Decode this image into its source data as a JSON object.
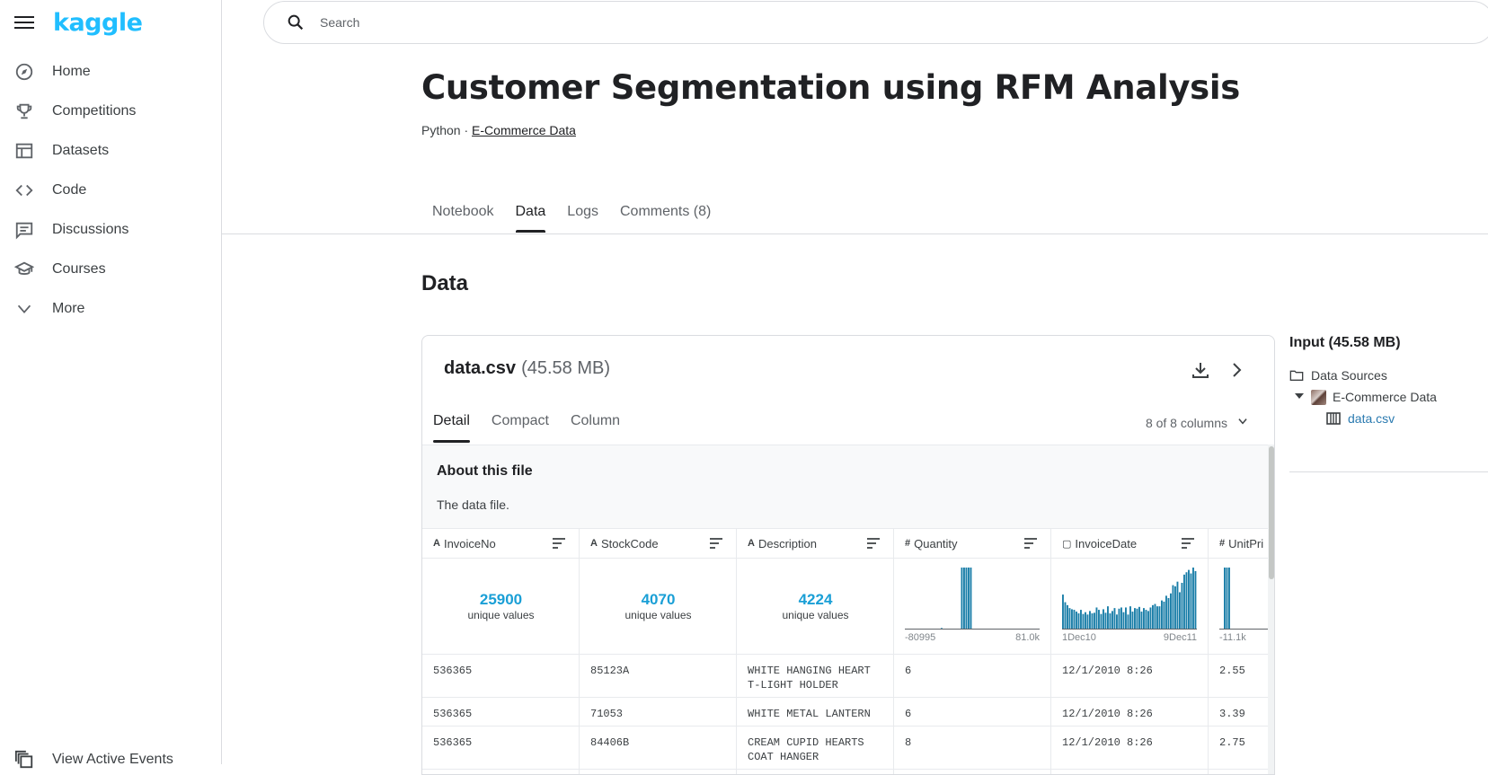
{
  "brand": {
    "logo_text": "kaggle",
    "accent": "#20beff"
  },
  "sidebar": {
    "items": [
      {
        "label": "Home",
        "icon": "compass-icon"
      },
      {
        "label": "Competitions",
        "icon": "trophy-icon"
      },
      {
        "label": "Datasets",
        "icon": "table-icon"
      },
      {
        "label": "Code",
        "icon": "code-icon"
      },
      {
        "label": "Discussions",
        "icon": "comments-icon"
      },
      {
        "label": "Courses",
        "icon": "school-icon"
      },
      {
        "label": "More",
        "icon": "chevron-down-icon"
      }
    ],
    "bottom_item": {
      "label": "View Active Events",
      "icon": "events-icon"
    }
  },
  "search": {
    "placeholder": "Search"
  },
  "notebook": {
    "title": "Customer Segmentation using RFM Analysis",
    "language": "Python",
    "separator": " · ",
    "dataset_link": "E-Commerce Data"
  },
  "tabs": [
    {
      "label": "Notebook",
      "active": false
    },
    {
      "label": "Data",
      "active": true
    },
    {
      "label": "Logs",
      "active": false
    },
    {
      "label": "Comments (8)",
      "active": false
    }
  ],
  "section_title": "Data",
  "file": {
    "name": "data.csv",
    "size": "(45.58 MB)",
    "view_tabs": [
      "Detail",
      "Compact",
      "Column"
    ],
    "columns_selector": "8 of 8 columns",
    "about_title": "About this file",
    "about_text": "The data file."
  },
  "table": {
    "columns": [
      {
        "name": "InvoiceNo",
        "type_icon": "A",
        "kind": "string",
        "unique": "25900",
        "unique_label": "unique values"
      },
      {
        "name": "StockCode",
        "type_icon": "A",
        "kind": "string",
        "unique": "4070",
        "unique_label": "unique values"
      },
      {
        "name": "Description",
        "type_icon": "A",
        "kind": "string",
        "unique": "4224",
        "unique_label": "unique values"
      },
      {
        "name": "Quantity",
        "type_icon": "#",
        "kind": "hist",
        "min_label": "-80995",
        "max_label": "81.0k"
      },
      {
        "name": "InvoiceDate",
        "type_icon": "▢",
        "kind": "hist",
        "min_label": "1Dec10",
        "max_label": "9Dec11"
      },
      {
        "name": "UnitPri",
        "type_icon": "#",
        "kind": "hist",
        "min_label": "-11.1k",
        "max_label": ""
      }
    ],
    "rows": [
      [
        "536365",
        "85123A",
        "WHITE HANGING HEART T-LIGHT HOLDER",
        "6",
        "12/1/2010 8:26",
        "2.55"
      ],
      [
        "536365",
        "71053",
        "WHITE METAL LANTERN",
        "6",
        "12/1/2010 8:26",
        "3.39"
      ],
      [
        "536365",
        "84406B",
        "CREAM CUPID HEARTS COAT HANGER",
        "8",
        "12/1/2010 8:26",
        "2.75"
      ]
    ],
    "histograms": {
      "Quantity": [
        0,
        0,
        0,
        0,
        0,
        0,
        0,
        0,
        0,
        0,
        0,
        0,
        0,
        0,
        0,
        0,
        1,
        0,
        0,
        0,
        0,
        0,
        0,
        0,
        0,
        100,
        100,
        100,
        100,
        100,
        0,
        0,
        0,
        0,
        0,
        0,
        0,
        0,
        0,
        0,
        0,
        0,
        0,
        0,
        0,
        0,
        0,
        0,
        0,
        0,
        0,
        0,
        0,
        0,
        0,
        0,
        0,
        0,
        0,
        0
      ],
      "InvoiceDate": [
        58,
        45,
        40,
        35,
        33,
        32,
        29,
        26,
        32,
        25,
        28,
        24,
        30,
        26,
        27,
        36,
        32,
        25,
        33,
        27,
        38,
        26,
        30,
        35,
        24,
        34,
        36,
        28,
        36,
        24,
        38,
        29,
        35,
        34,
        37,
        29,
        35,
        32,
        30,
        36,
        40,
        42,
        38,
        38,
        48,
        46,
        56,
        52,
        60,
        74,
        72,
        80,
        62,
        78,
        92,
        96,
        100,
        94,
        104,
        98
      ],
      "UnitPri": [
        0,
        0,
        100,
        100,
        100,
        0,
        0,
        0,
        0,
        0,
        0,
        0,
        0,
        0,
        0,
        0,
        0,
        0,
        0,
        0,
        0,
        0,
        0,
        0,
        0,
        0,
        0,
        0,
        0,
        0
      ]
    },
    "bar_color": "#1a7ea8"
  },
  "input_panel": {
    "title": "Input (45.58 MB)",
    "data_sources_label": "Data Sources",
    "dataset": "E-Commerce Data",
    "file": "data.csv"
  }
}
